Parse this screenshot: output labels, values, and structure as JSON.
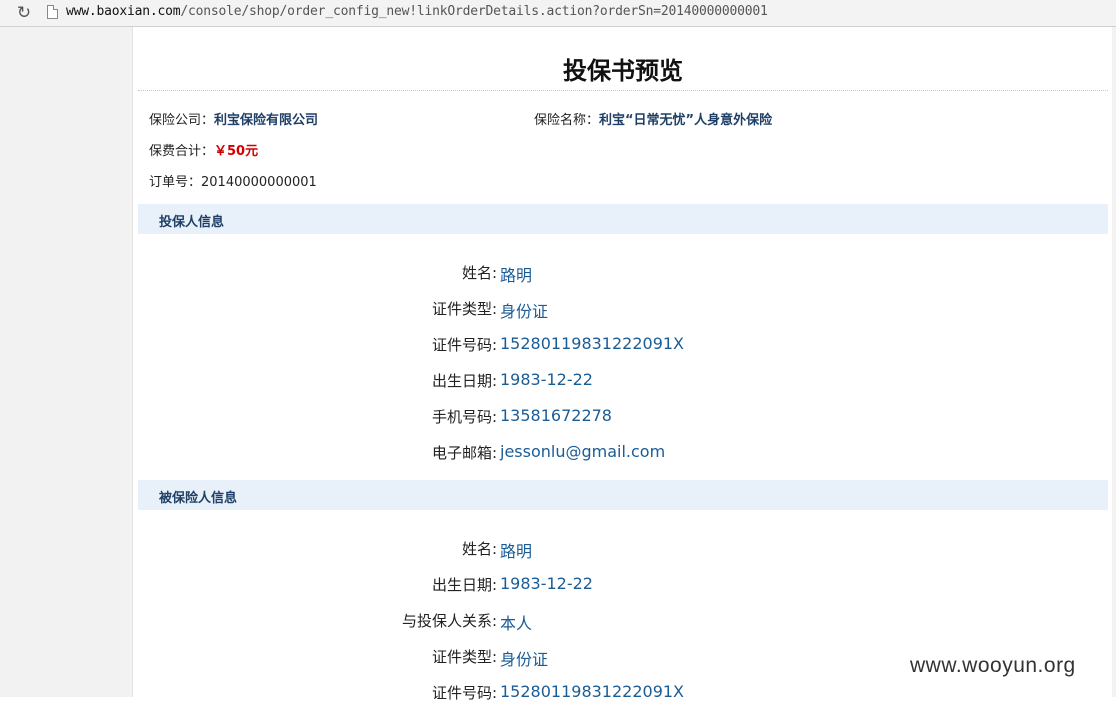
{
  "browser": {
    "reload_glyph": "↻",
    "url_host": "www.baoxian.com",
    "url_path": "/console/shop/order_config_new!linkOrderDetails.action?orderSn=20140000000001"
  },
  "page": {
    "title": "投保书预览"
  },
  "summary": {
    "company_label": "保险公司：",
    "company_value": "利宝保险有限公司",
    "product_label": "保险名称：",
    "product_value": "利宝“日常无忧”人身意外保险",
    "premium_label": "保费合计：",
    "premium_value": "￥50元",
    "order_label": "订单号：",
    "order_value": "20140000000001"
  },
  "policyholder": {
    "section_title": "投保人信息",
    "fields": [
      {
        "label": "姓名:",
        "value": "路明"
      },
      {
        "label": "证件类型:",
        "value": "身份证"
      },
      {
        "label": "证件号码:",
        "value": "15280119831222091X"
      },
      {
        "label": "出生日期:",
        "value": "1983-12-22"
      },
      {
        "label": "手机号码:",
        "value": "13581672278"
      },
      {
        "label": "电子邮箱:",
        "value": "jessonlu@gmail.com"
      }
    ]
  },
  "insured": {
    "section_title": "被保险人信息",
    "fields": [
      {
        "label": "姓名:",
        "value": "路明"
      },
      {
        "label": "出生日期:",
        "value": "1983-12-22"
      },
      {
        "label": "与投保人关系:",
        "value": "本人"
      },
      {
        "label": "证件类型:",
        "value": "身份证"
      },
      {
        "label": "证件号码:",
        "value": "15280119831222091X"
      }
    ]
  },
  "watermark": "www.wooyun.org"
}
